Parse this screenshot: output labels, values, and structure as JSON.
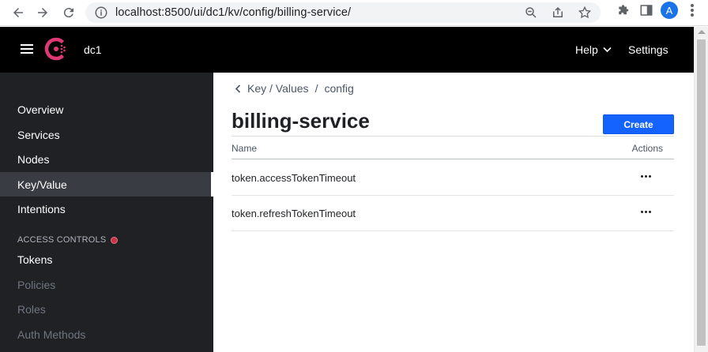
{
  "browser": {
    "url": "localhost:8500/ui/dc1/kv/config/billing-service/",
    "avatar_letter": "A"
  },
  "header": {
    "datacenter": "dc1",
    "help_label": "Help",
    "settings_label": "Settings"
  },
  "sidebar": {
    "items": [
      {
        "label": "Overview"
      },
      {
        "label": "Services"
      },
      {
        "label": "Nodes"
      },
      {
        "label": "Key/Value",
        "active": true
      },
      {
        "label": "Intentions"
      }
    ],
    "access_heading": "ACCESS CONTROLS",
    "access_items": [
      {
        "label": "Tokens",
        "disabled": false
      },
      {
        "label": "Policies",
        "disabled": true
      },
      {
        "label": "Roles",
        "disabled": true
      },
      {
        "label": "Auth Methods",
        "disabled": true
      }
    ]
  },
  "main": {
    "breadcrumb": {
      "parent": "Key / Values",
      "separator": "/",
      "current": "config"
    },
    "title": "billing-service",
    "create_label": "Create",
    "table": {
      "headers": {
        "name": "Name",
        "actions": "Actions"
      },
      "rows": [
        {
          "name": "token.accessTokenTimeout"
        },
        {
          "name": "token.refreshTokenTimeout"
        }
      ]
    }
  },
  "colors": {
    "accent": "#1563ff",
    "sidebar_bg": "#1f2124",
    "header_bg": "#000000",
    "brand": "#e03875"
  },
  "icons": [
    "back-arrow-icon",
    "forward-arrow-icon",
    "reload-icon",
    "info-icon",
    "zoom-icon",
    "share-icon",
    "star-icon",
    "extensions-icon",
    "sidebar-icon",
    "menu-icon",
    "hamburger-icon",
    "consul-logo-icon",
    "chevron-down-icon",
    "chevron-left-icon",
    "ellipsis-icon"
  ]
}
